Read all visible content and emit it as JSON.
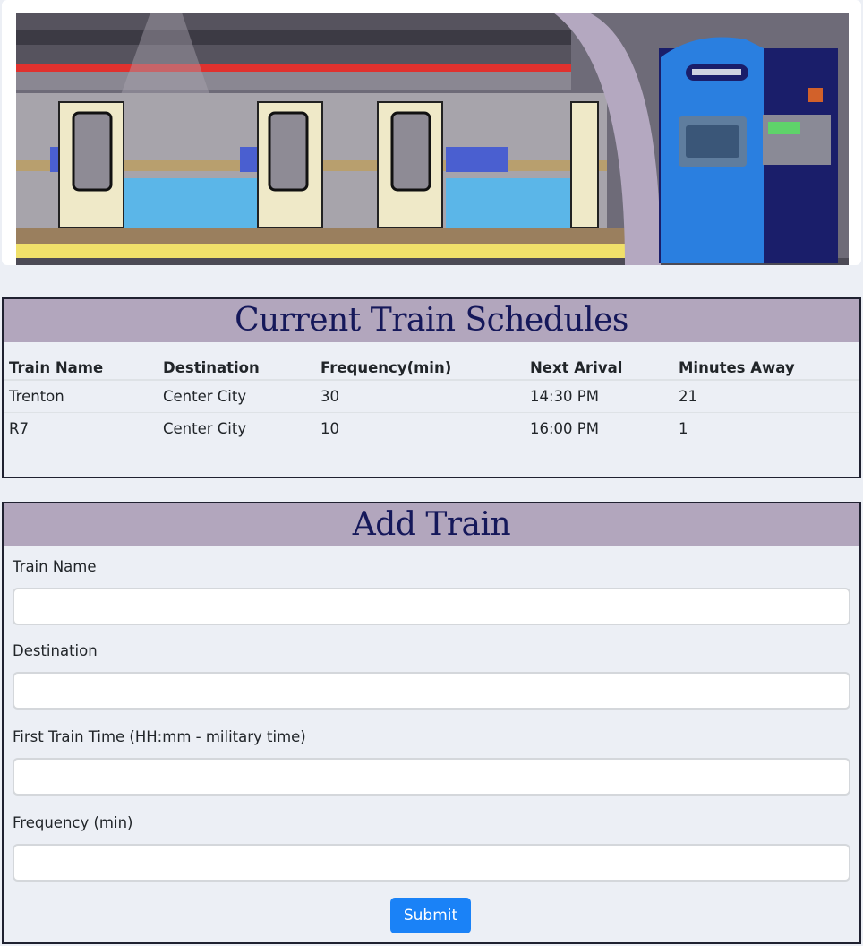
{
  "banner": {
    "icon": "subway-train-illustration"
  },
  "schedules": {
    "title": "Current Train Schedules",
    "columns": [
      "Train Name",
      "Destination",
      "Frequency(min)",
      "Next Arival",
      "Minutes Away"
    ],
    "rows": [
      [
        "Trenton",
        "Center City",
        "30",
        "14:30 PM",
        "21"
      ],
      [
        "R7",
        "Center City",
        "10",
        "16:00 PM",
        "1"
      ]
    ]
  },
  "add_train": {
    "title": "Add Train",
    "train_name_label": "Train Name",
    "destination_label": "Destination",
    "first_time_label": "First Train Time (HH:mm - military time)",
    "frequency_label": "Frequency (min)",
    "submit_label": "Submit"
  },
  "colors": {
    "header_bg": "#b2a6bd",
    "header_text": "#15185a",
    "page_bg": "#eceff5",
    "button": "#1a82f7"
  }
}
